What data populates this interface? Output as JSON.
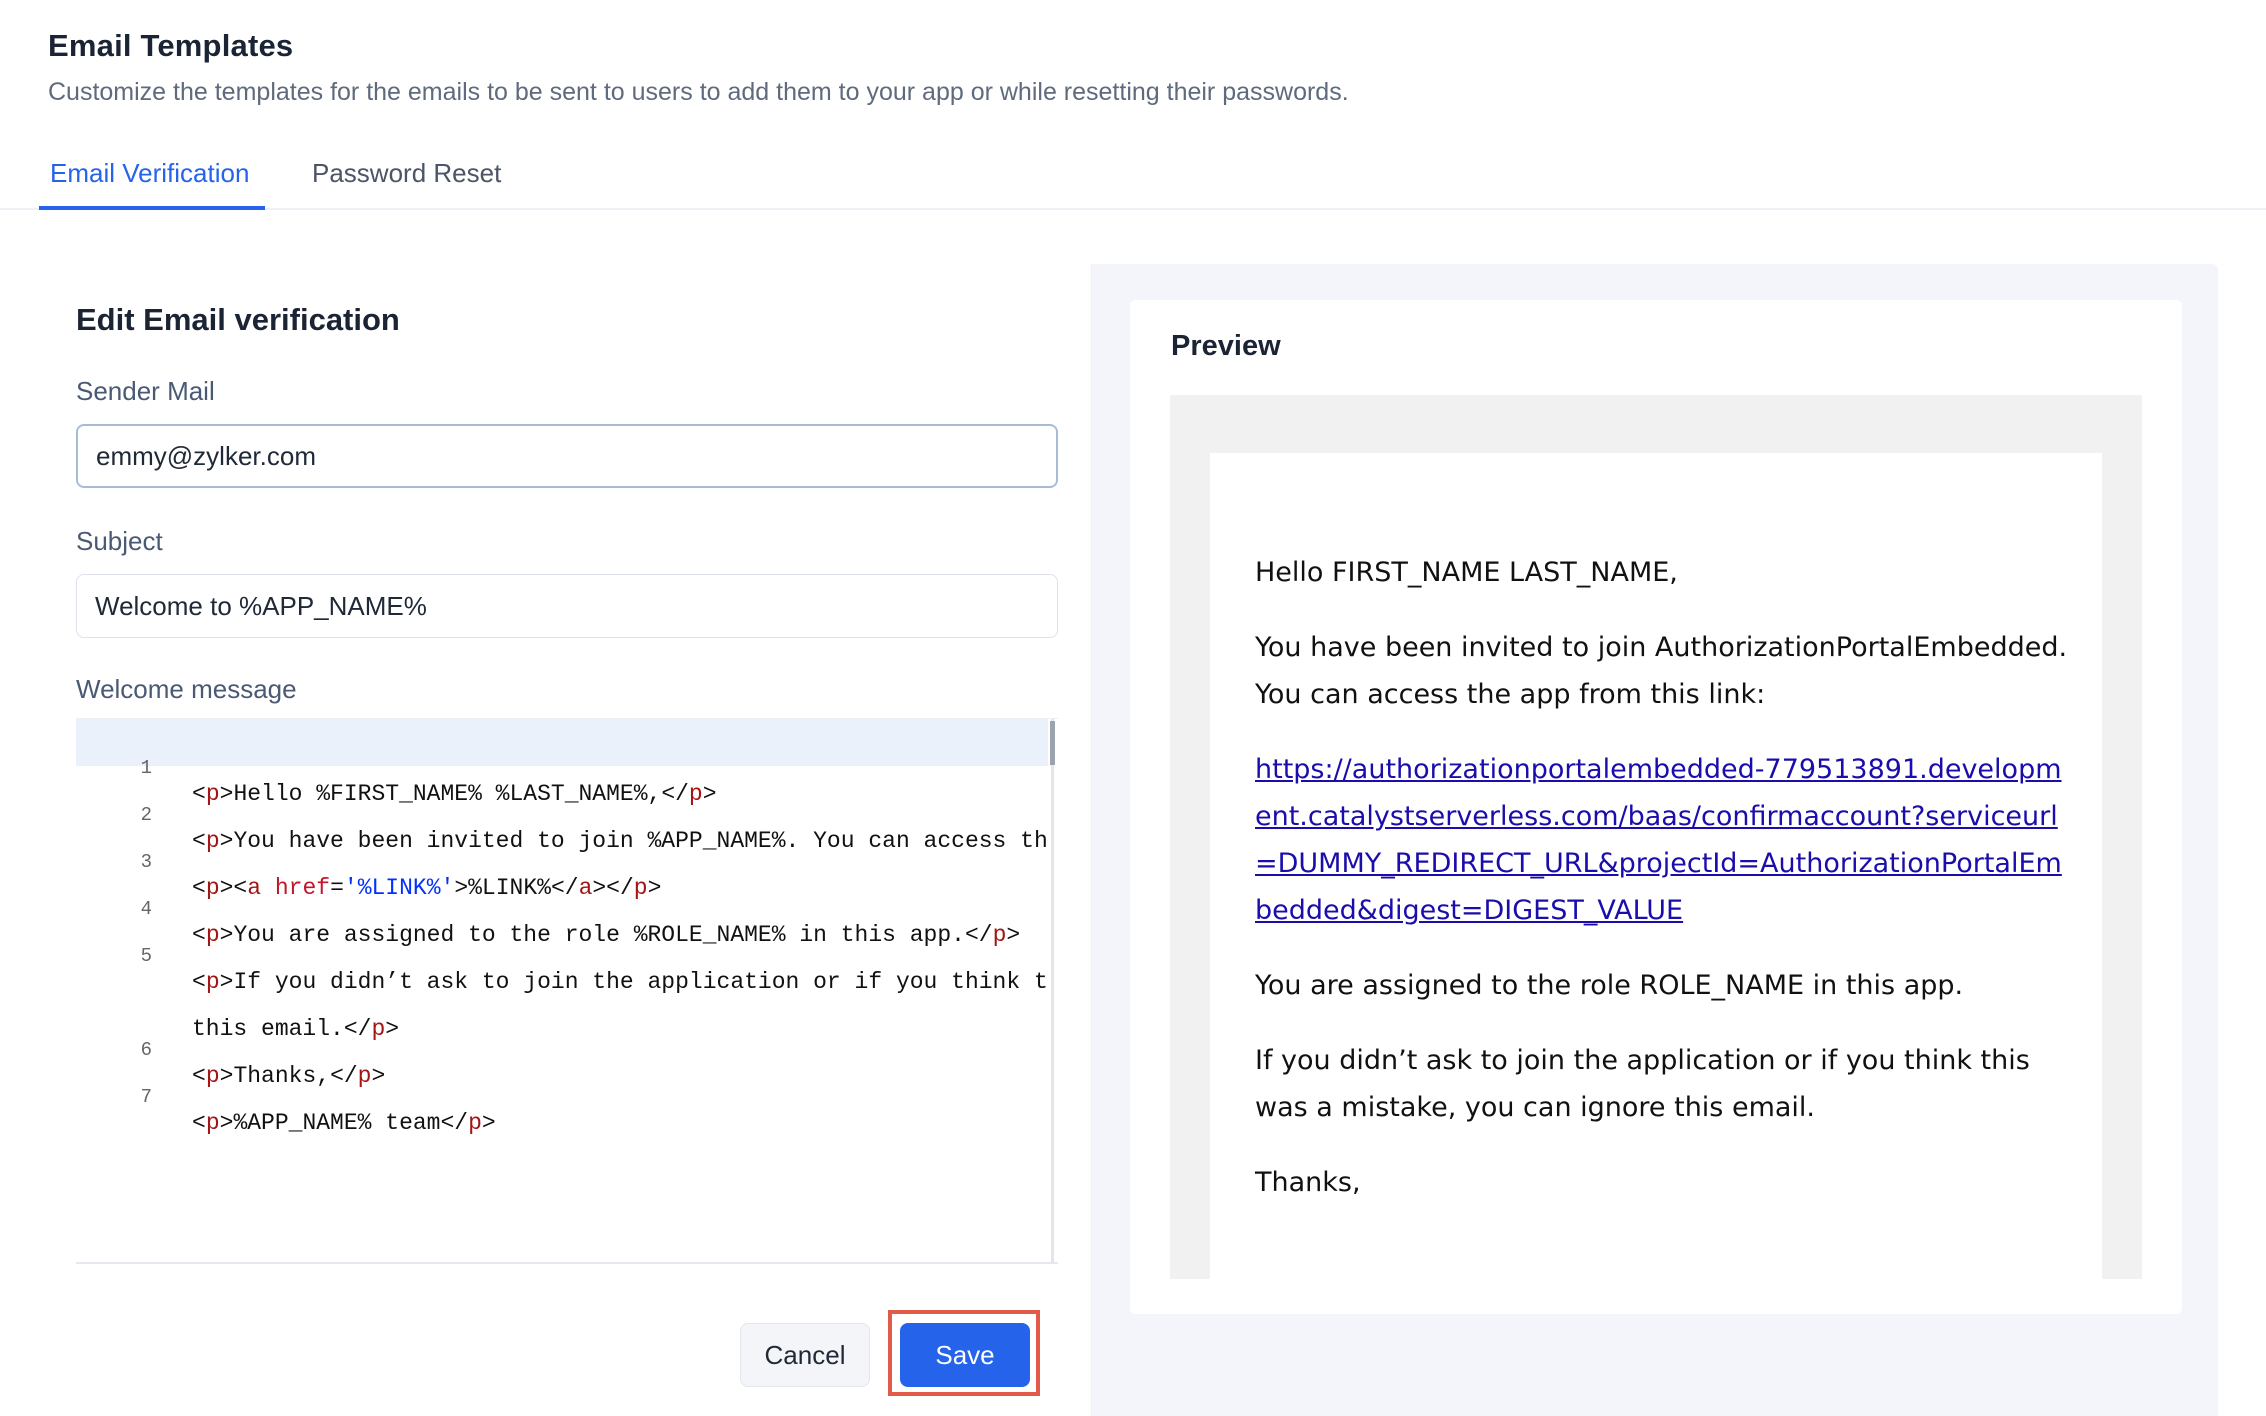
{
  "header": {
    "title": "Email Templates",
    "subtitle": "Customize the templates for the emails to be sent to users to add them to your app or while resetting their passwords."
  },
  "tabs": [
    {
      "label": "Email Verification",
      "active": true
    },
    {
      "label": "Password Reset",
      "active": false
    }
  ],
  "edit": {
    "title": "Edit Email verification",
    "sender_label": "Sender Mail",
    "sender_value": "emmy@zylker.com",
    "subject_label": "Subject",
    "subject_value": "Welcome to %APP_NAME%",
    "message_label": "Welcome message",
    "code_lines": [
      {
        "no": "1",
        "text": "<p>Hello %FIRST_NAME% %LAST_NAME%,</p>"
      },
      {
        "no": "2",
        "text": "<p>You have been invited to join %APP_NAME%. You can access th"
      },
      {
        "no": "3",
        "text": "<p><a href='%LINK%'>%LINK%</a></p>"
      },
      {
        "no": "4",
        "text": "<p>You are assigned to the role %ROLE_NAME% in this app.</p>"
      },
      {
        "no": "5",
        "text": "<p>If you didn’t ask to join the application or if you think t"
      },
      {
        "no": "",
        "text": "this email.</p>"
      },
      {
        "no": "6",
        "text": "<p>Thanks,</p>"
      },
      {
        "no": "7",
        "text": "<p>%APP_NAME% team</p>"
      }
    ],
    "cancel_label": "Cancel",
    "save_label": "Save"
  },
  "preview": {
    "title": "Preview",
    "greeting": "Hello FIRST_NAME LAST_NAME,",
    "invite": "You have been invited to join AuthorizationPortalEmbedded. You can access the app from this link:",
    "link": "https://authorizationportalembedded-779513891.development.catalystserverless.com/baas/confirmaccount?serviceurl=DUMMY_REDIRECT_URL&projectId=AuthorizationPortalEmbedded&digest=DIGEST_VALUE",
    "role": "You are assigned to the role ROLE_NAME in this app.",
    "ignore": "If you didn’t ask to join the application or if you think this was a mistake, you can ignore this email.",
    "thanks": "Thanks,"
  },
  "colors": {
    "accent": "#2563eb",
    "save_highlight_border": "#e25a4a"
  }
}
